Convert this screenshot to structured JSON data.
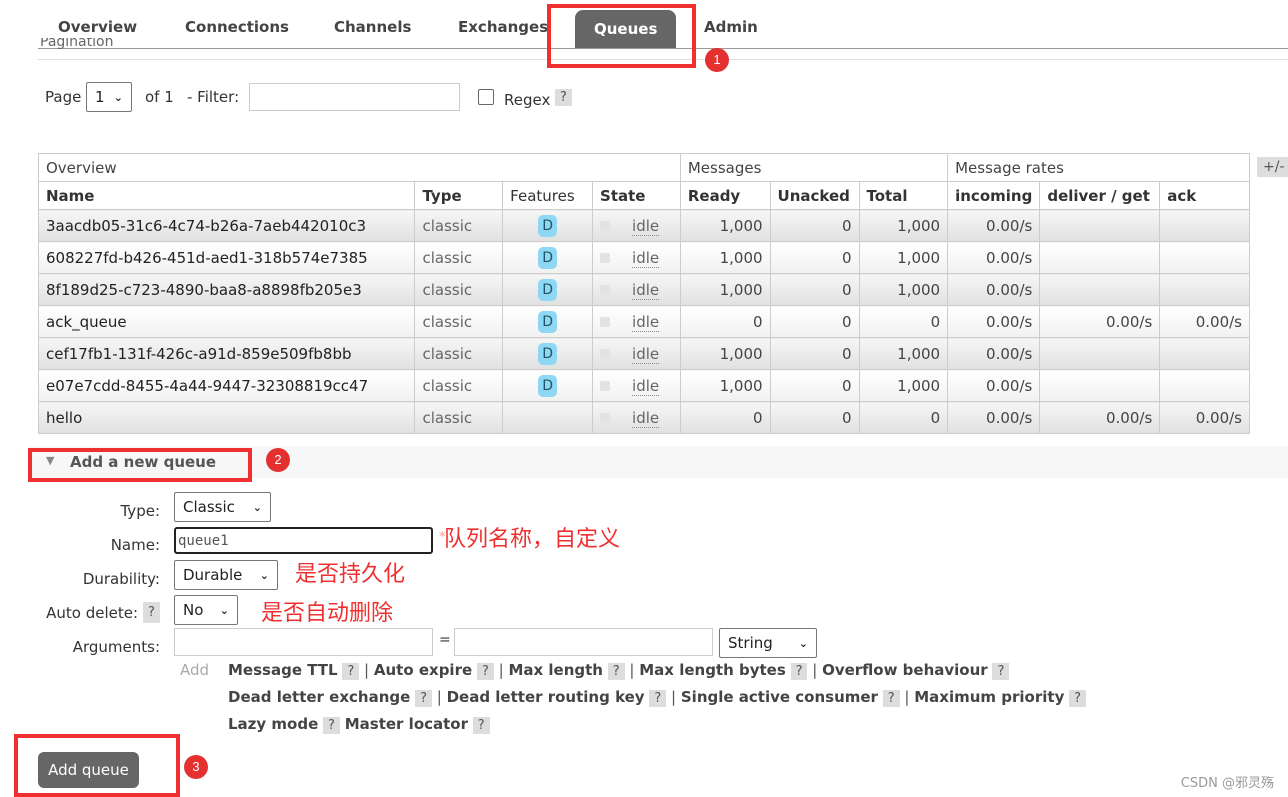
{
  "nav": {
    "tabs": [
      "Overview",
      "Connections",
      "Channels",
      "Exchanges",
      "Queues",
      "Admin"
    ],
    "active": "Queues"
  },
  "pagination": {
    "section_label": "Pagination",
    "page_label": "Page",
    "page_value": "1",
    "of_label": "of 1",
    "filter_label": "- Filter:",
    "filter_value": "",
    "regex_label": "Regex",
    "help": "?"
  },
  "table": {
    "group_headers": [
      "Overview",
      "Messages",
      "Message rates"
    ],
    "plus_minus": "+/-",
    "columns": [
      "Name",
      "Type",
      "Features",
      "State",
      "Ready",
      "Unacked",
      "Total",
      "incoming",
      "deliver / get",
      "ack"
    ],
    "rows": [
      {
        "name": "3aacdb05-31c6-4c74-b26a-7aeb442010c3",
        "type": "classic",
        "features": "D",
        "state": "idle",
        "ready": "1,000",
        "unacked": "0",
        "total": "1,000",
        "incoming": "0.00/s",
        "deliver": "",
        "ack": ""
      },
      {
        "name": "608227fd-b426-451d-aed1-318b574e7385",
        "type": "classic",
        "features": "D",
        "state": "idle",
        "ready": "1,000",
        "unacked": "0",
        "total": "1,000",
        "incoming": "0.00/s",
        "deliver": "",
        "ack": ""
      },
      {
        "name": "8f189d25-c723-4890-baa8-a8898fb205e3",
        "type": "classic",
        "features": "D",
        "state": "idle",
        "ready": "1,000",
        "unacked": "0",
        "total": "1,000",
        "incoming": "0.00/s",
        "deliver": "",
        "ack": ""
      },
      {
        "name": "ack_queue",
        "type": "classic",
        "features": "D",
        "state": "idle",
        "ready": "0",
        "unacked": "0",
        "total": "0",
        "incoming": "0.00/s",
        "deliver": "0.00/s",
        "ack": "0.00/s"
      },
      {
        "name": "cef17fb1-131f-426c-a91d-859e509fb8bb",
        "type": "classic",
        "features": "D",
        "state": "idle",
        "ready": "1,000",
        "unacked": "0",
        "total": "1,000",
        "incoming": "0.00/s",
        "deliver": "",
        "ack": ""
      },
      {
        "name": "e07e7cdd-8455-4a44-9447-32308819cc47",
        "type": "classic",
        "features": "D",
        "state": "idle",
        "ready": "1,000",
        "unacked": "0",
        "total": "1,000",
        "incoming": "0.00/s",
        "deliver": "",
        "ack": ""
      },
      {
        "name": "hello",
        "type": "classic",
        "features": "",
        "state": "idle",
        "ready": "0",
        "unacked": "0",
        "total": "0",
        "incoming": "0.00/s",
        "deliver": "0.00/s",
        "ack": "0.00/s"
      }
    ]
  },
  "add_queue": {
    "title": "Add a new queue",
    "type_label": "Type:",
    "type_value": "Classic",
    "name_label": "Name:",
    "name_value": "queue1",
    "durability_label": "Durability:",
    "durability_value": "Durable",
    "auto_delete_label": "Auto delete:",
    "auto_delete_value": "No",
    "arguments_label": "Arguments:",
    "eq": "=",
    "arg_type": "String",
    "add_label": "Add",
    "options": [
      [
        "Message TTL",
        "Auto expire",
        "Max length",
        "Max length bytes",
        "Overflow behaviour"
      ],
      [
        "Dead letter exchange",
        "Dead letter routing key",
        "Single active consumer",
        "Maximum priority"
      ],
      [
        "Lazy mode",
        "Master locator"
      ]
    ],
    "submit": "Add queue",
    "required_mark": "*"
  },
  "annotations": {
    "badge1": "1",
    "badge2": "2",
    "badge3": "3",
    "name_note": "队列名称，自定义",
    "durable_note": "是否持久化",
    "autodelete_note": "是否自动删除",
    "color": "#f03030"
  },
  "watermark": "CSDN @邪灵殇"
}
